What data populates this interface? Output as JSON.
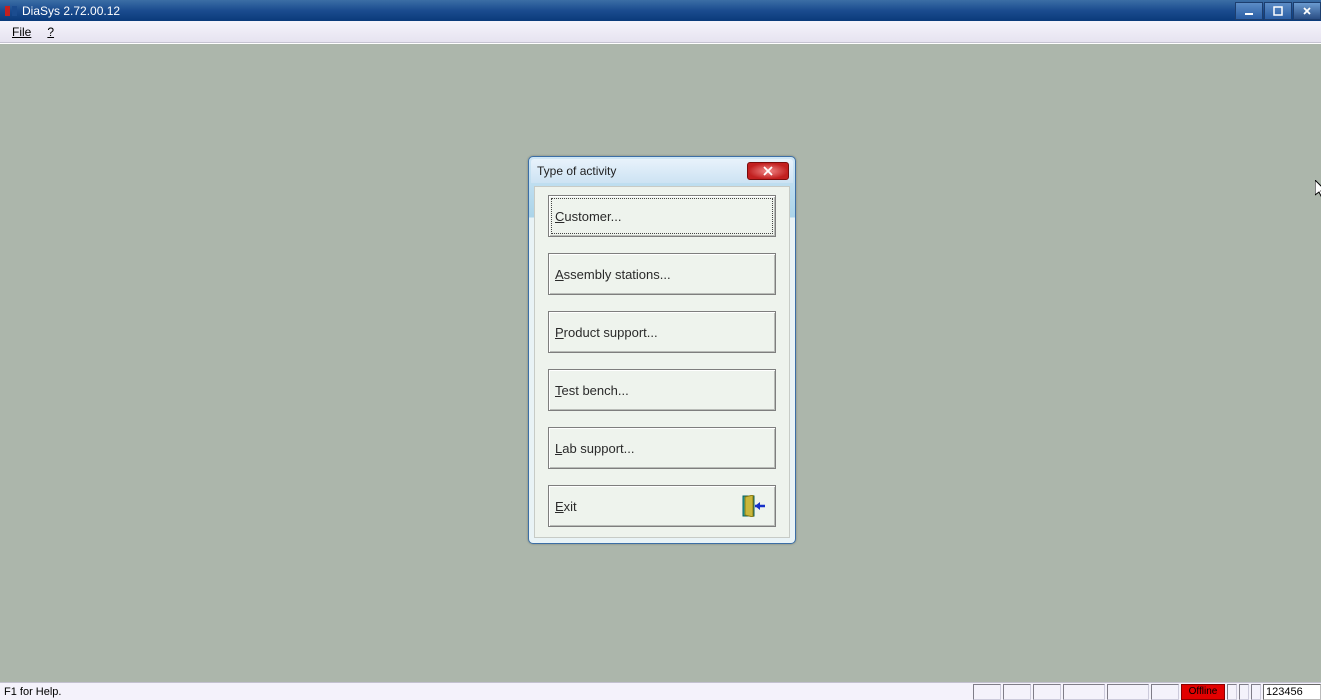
{
  "window": {
    "title": "DiaSys 2.72.00.12"
  },
  "menu": {
    "file": "File",
    "help": "?"
  },
  "dialog": {
    "title": "Type of activity",
    "buttons": {
      "customer": "ustomer...",
      "customer_mn": "C",
      "assembly": "ssembly stations...",
      "assembly_mn": "A",
      "product": "roduct support...",
      "product_mn": "P",
      "test": "est bench...",
      "test_mn": "T",
      "lab": "ab support...",
      "lab_mn": "L",
      "exit": "xit",
      "exit_mn": "E"
    }
  },
  "statusbar": {
    "help": "F1 for Help.",
    "offline": "Offline",
    "code": "123456"
  }
}
